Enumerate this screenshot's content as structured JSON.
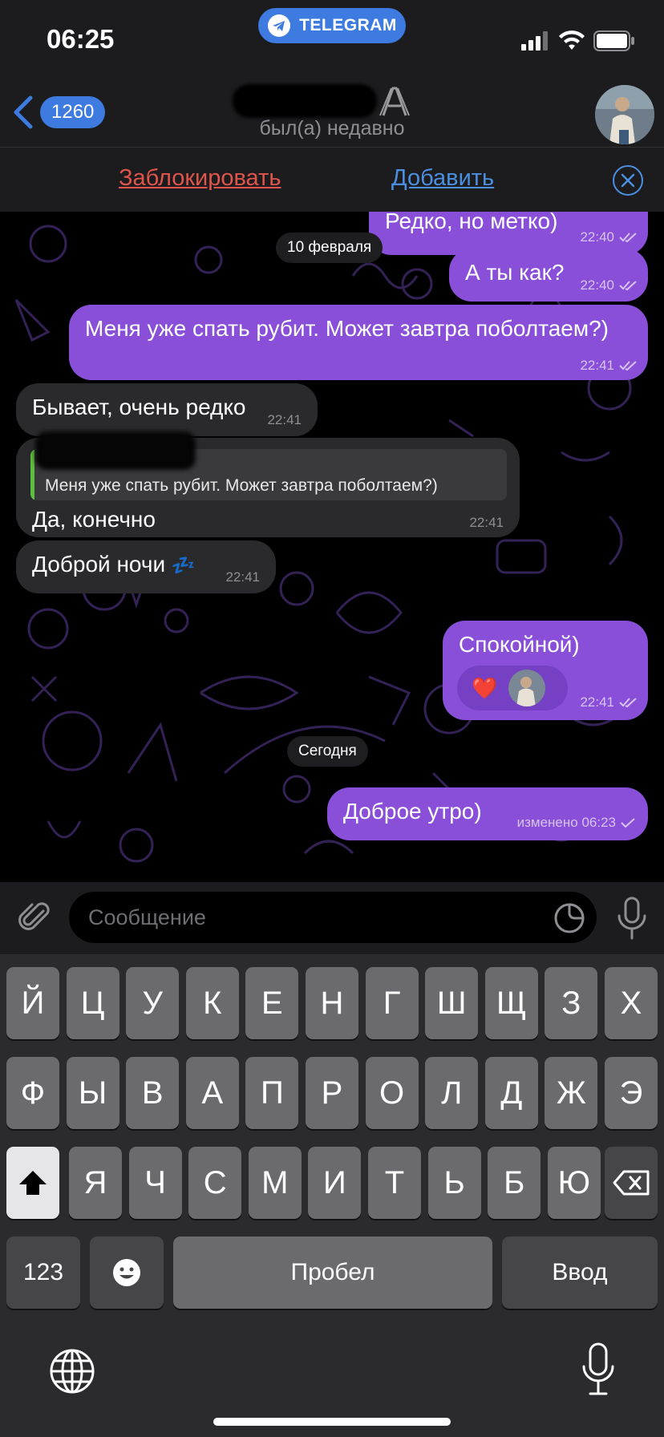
{
  "status_bar": {
    "time": "06:25",
    "app_pill": "TELEGRAM"
  },
  "header": {
    "back_count": "1260",
    "contact_status": "был(а) недавно"
  },
  "actions": {
    "block": "Заблокировать",
    "add": "Добавить"
  },
  "messages": [
    {
      "dir": "out",
      "text": "Редко, но метко)",
      "time": "22:40",
      "read": true
    },
    {
      "dir": "date",
      "text": "10 февраля"
    },
    {
      "dir": "out",
      "text": "А ты как?",
      "time": "22:40",
      "read": true
    },
    {
      "dir": "out",
      "text": "Меня уже спать рубит. Может завтра поболтаем?)",
      "time": "22:41",
      "read": true
    },
    {
      "dir": "in",
      "text": "Бывает, очень редко",
      "time": "22:41"
    },
    {
      "dir": "in",
      "text": "Да, конечно",
      "time": "22:41",
      "reply_text": "Меня уже спать рубит. Может завтра поболтаем?)"
    },
    {
      "dir": "in",
      "text": "Доброй ночи",
      "time": "22:41",
      "emoji": "💤"
    },
    {
      "dir": "out",
      "text": "Спокойной)",
      "time": "22:41",
      "read": true,
      "reaction": "❤️"
    },
    {
      "dir": "date",
      "text": "Сегодня"
    },
    {
      "dir": "out",
      "text": "Доброе утро)",
      "time": "изменено 06:23",
      "read": false
    }
  ],
  "composer": {
    "placeholder": "Сообщение"
  },
  "keyboard": {
    "row1": [
      "Й",
      "Ц",
      "У",
      "К",
      "Е",
      "Н",
      "Г",
      "Ш",
      "Щ",
      "З",
      "Х"
    ],
    "row2": [
      "Ф",
      "Ы",
      "В",
      "А",
      "П",
      "Р",
      "О",
      "Л",
      "Д",
      "Ж",
      "Э"
    ],
    "row3": [
      "Я",
      "Ч",
      "С",
      "М",
      "И",
      "Т",
      "Ь",
      "Б",
      "Ю"
    ],
    "numbers": "123",
    "space": "Пробел",
    "enter": "Ввод"
  },
  "colors": {
    "accent": "#3d7be0",
    "outgoing_bubble": "#8a4fd8",
    "incoming_bubble": "#2a2a2c",
    "danger": "#e0554b"
  },
  "icons": [
    "telegram-plane-icon",
    "signal-icon",
    "wifi-icon",
    "battery-icon",
    "chevron-left-icon",
    "close-icon",
    "attach-icon",
    "sticker-icon",
    "mic-icon",
    "shift-icon",
    "backspace-icon",
    "emoji-icon",
    "globe-icon",
    "double-check-icon",
    "single-check-icon",
    "heart-icon",
    "zzz-icon"
  ]
}
